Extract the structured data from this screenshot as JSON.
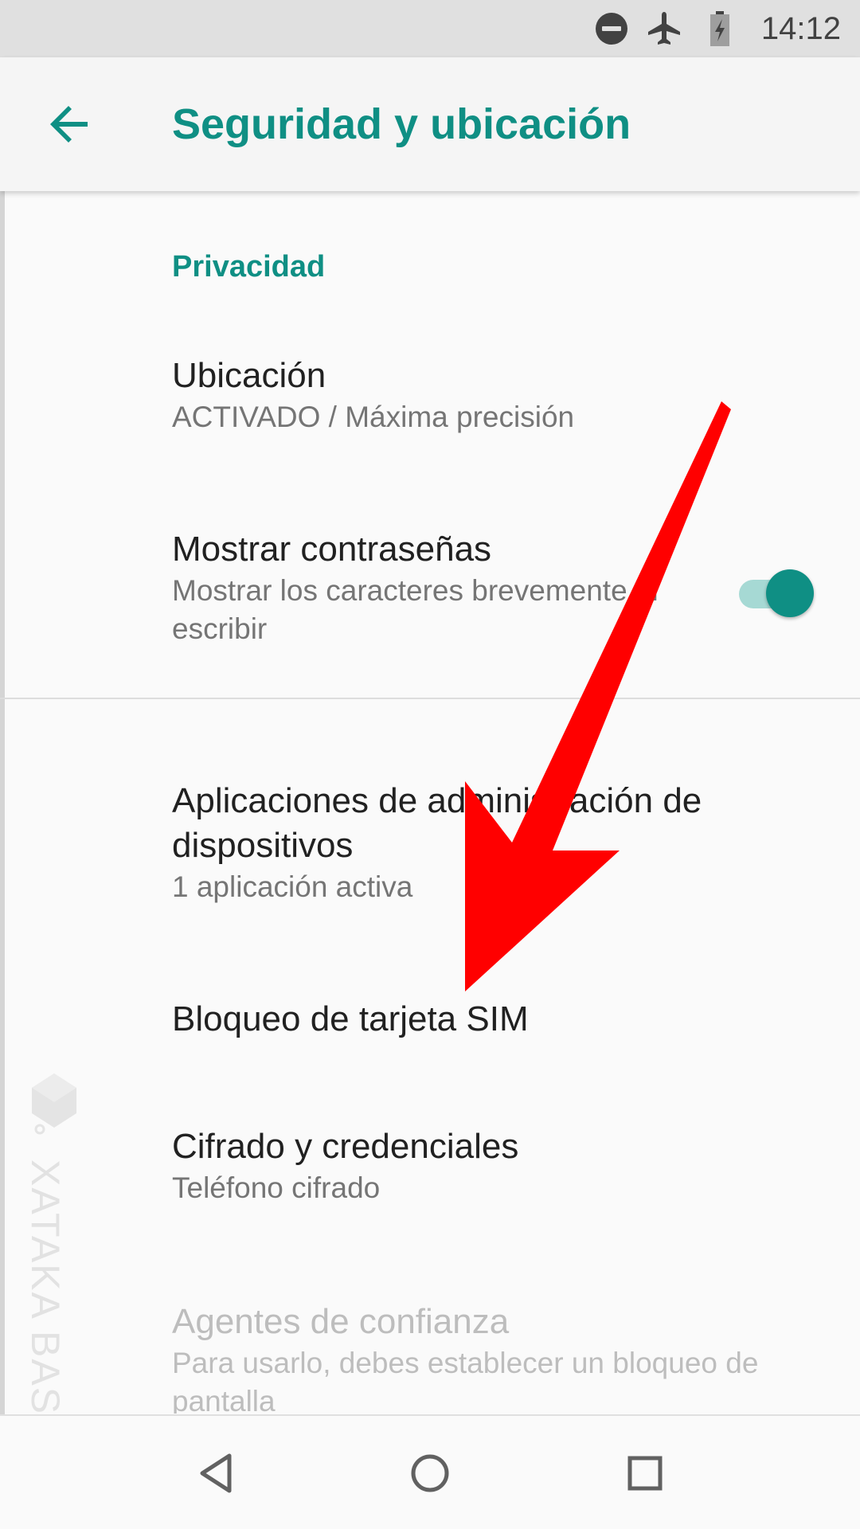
{
  "status_bar": {
    "time": "14:12",
    "icons": [
      "do-not-disturb-icon",
      "airplane-mode-icon",
      "battery-charging-icon"
    ]
  },
  "app_bar": {
    "back_icon": "arrow-back-icon",
    "title": "Seguridad y ubicación"
  },
  "section": {
    "header": "Privacidad"
  },
  "preferences": {
    "location": {
      "title": "Ubicación",
      "summary": "ACTIVADO / Máxima precisión"
    },
    "show_passwords": {
      "title": "Mostrar contraseñas",
      "summary": "Mostrar los caracteres brevemente al escribir",
      "enabled": true
    },
    "device_admin": {
      "title": "Aplicaciones de administración de dispositivos",
      "summary": "1 aplicación activa"
    },
    "sim_lock": {
      "title": "Bloqueo de tarjeta SIM"
    },
    "encryption": {
      "title": "Cifrado y credenciales",
      "summary": "Teléfono cifrado"
    },
    "trust_agents": {
      "title": "Agentes de confianza",
      "summary": "Para usarlo, debes establecer un bloqueo de pantalla",
      "disabled": true
    }
  },
  "nav_bar": {
    "icons": [
      "nav-back-icon",
      "nav-home-icon",
      "nav-recents-icon"
    ]
  },
  "watermark": {
    "text": "XATAKA BASICS"
  },
  "colors": {
    "accent": "#0f8f84",
    "toggle_track": "#a6d9d4",
    "annotation_arrow": "#ff0000",
    "status_bar_bg": "#e0e0e0"
  }
}
